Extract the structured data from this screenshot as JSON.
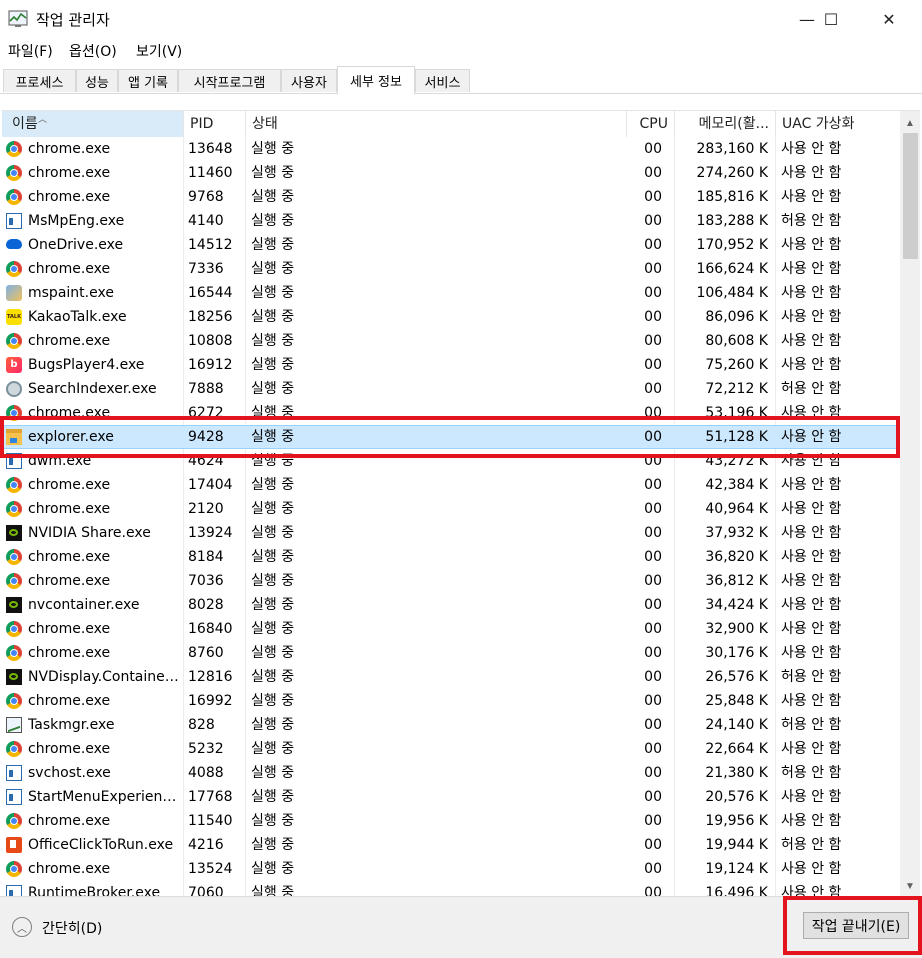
{
  "window": {
    "title": "작업 관리자",
    "minimize": "—",
    "maximize": "☐",
    "close": "✕"
  },
  "menu": [
    "파일(F)",
    "옵션(O)",
    "보기(V)"
  ],
  "tabs": [
    "프로세스",
    "성능",
    "앱 기록",
    "시작프로그램",
    "사용자",
    "세부 정보",
    "서비스"
  ],
  "active_tab": "세부 정보",
  "columns": {
    "name": "이름",
    "pid": "PID",
    "status": "상태",
    "cpu": "CPU",
    "memory": "메모리(활...",
    "uac": "UAC 가상화"
  },
  "rows": [
    {
      "name": "chrome.exe",
      "pid": "13648",
      "status": "실행 중",
      "cpu": "00",
      "mem": "283,160 K",
      "uac": "사용 안 함",
      "icon": "chrome-icon"
    },
    {
      "name": "chrome.exe",
      "pid": "11460",
      "status": "실행 중",
      "cpu": "00",
      "mem": "274,260 K",
      "uac": "사용 안 함",
      "icon": "chrome-icon"
    },
    {
      "name": "chrome.exe",
      "pid": "9768",
      "status": "실행 중",
      "cpu": "00",
      "mem": "185,816 K",
      "uac": "사용 안 함",
      "icon": "chrome-icon"
    },
    {
      "name": "MsMpEng.exe",
      "pid": "4140",
      "status": "실행 중",
      "cpu": "00",
      "mem": "183,288 K",
      "uac": "허용 안 함",
      "icon": "service-window-icon"
    },
    {
      "name": "OneDrive.exe",
      "pid": "14512",
      "status": "실행 중",
      "cpu": "00",
      "mem": "170,952 K",
      "uac": "사용 안 함",
      "icon": "onedrive-cloud-icon"
    },
    {
      "name": "chrome.exe",
      "pid": "7336",
      "status": "실행 중",
      "cpu": "00",
      "mem": "166,624 K",
      "uac": "사용 안 함",
      "icon": "chrome-icon"
    },
    {
      "name": "mspaint.exe",
      "pid": "16544",
      "status": "실행 중",
      "cpu": "00",
      "mem": "106,484 K",
      "uac": "사용 안 함",
      "icon": "paint-icon"
    },
    {
      "name": "KakaoTalk.exe",
      "pid": "18256",
      "status": "실행 중",
      "cpu": "00",
      "mem": "86,096 K",
      "uac": "사용 안 함",
      "icon": "kakaotalk-icon"
    },
    {
      "name": "chrome.exe",
      "pid": "10808",
      "status": "실행 중",
      "cpu": "00",
      "mem": "80,608 K",
      "uac": "사용 안 함",
      "icon": "chrome-icon"
    },
    {
      "name": "BugsPlayer4.exe",
      "pid": "16912",
      "status": "실행 중",
      "cpu": "00",
      "mem": "75,260 K",
      "uac": "사용 안 함",
      "icon": "bugs-player-icon"
    },
    {
      "name": "SearchIndexer.exe",
      "pid": "7888",
      "status": "실행 중",
      "cpu": "00",
      "mem": "72,212 K",
      "uac": "허용 안 함",
      "icon": "search-indexer-icon"
    },
    {
      "name": "chrome.exe",
      "pid": "6272",
      "status": "실행 중",
      "cpu": "00",
      "mem": "53,196 K",
      "uac": "사용 안 함",
      "icon": "chrome-icon"
    },
    {
      "name": "explorer.exe",
      "pid": "9428",
      "status": "실행 중",
      "cpu": "00",
      "mem": "51,128 K",
      "uac": "사용 안 함",
      "icon": "file-explorer-icon",
      "selected": true
    },
    {
      "name": "dwm.exe",
      "pid": "4624",
      "status": "실행 중",
      "cpu": "00",
      "mem": "43,272 K",
      "uac": "사용 안 함",
      "icon": "service-window-icon"
    },
    {
      "name": "chrome.exe",
      "pid": "17404",
      "status": "실행 중",
      "cpu": "00",
      "mem": "42,384 K",
      "uac": "사용 안 함",
      "icon": "chrome-icon"
    },
    {
      "name": "chrome.exe",
      "pid": "2120",
      "status": "실행 중",
      "cpu": "00",
      "mem": "40,964 K",
      "uac": "사용 안 함",
      "icon": "chrome-icon"
    },
    {
      "name": "NVIDIA Share.exe",
      "pid": "13924",
      "status": "실행 중",
      "cpu": "00",
      "mem": "37,932 K",
      "uac": "사용 안 함",
      "icon": "nvidia-icon"
    },
    {
      "name": "chrome.exe",
      "pid": "8184",
      "status": "실행 중",
      "cpu": "00",
      "mem": "36,820 K",
      "uac": "사용 안 함",
      "icon": "chrome-icon"
    },
    {
      "name": "chrome.exe",
      "pid": "7036",
      "status": "실행 중",
      "cpu": "00",
      "mem": "36,812 K",
      "uac": "사용 안 함",
      "icon": "chrome-icon"
    },
    {
      "name": "nvcontainer.exe",
      "pid": "8028",
      "status": "실행 중",
      "cpu": "00",
      "mem": "34,424 K",
      "uac": "사용 안 함",
      "icon": "nvidia-icon"
    },
    {
      "name": "chrome.exe",
      "pid": "16840",
      "status": "실행 중",
      "cpu": "00",
      "mem": "32,900 K",
      "uac": "사용 안 함",
      "icon": "chrome-icon"
    },
    {
      "name": "chrome.exe",
      "pid": "8760",
      "status": "실행 중",
      "cpu": "00",
      "mem": "30,176 K",
      "uac": "사용 안 함",
      "icon": "chrome-icon"
    },
    {
      "name": "NVDisplay.Container...",
      "pid": "12816",
      "status": "실행 중",
      "cpu": "00",
      "mem": "26,576 K",
      "uac": "허용 안 함",
      "icon": "nvidia-icon"
    },
    {
      "name": "chrome.exe",
      "pid": "16992",
      "status": "실행 중",
      "cpu": "00",
      "mem": "25,848 K",
      "uac": "사용 안 함",
      "icon": "chrome-icon"
    },
    {
      "name": "Taskmgr.exe",
      "pid": "828",
      "status": "실행 중",
      "cpu": "00",
      "mem": "24,140 K",
      "uac": "허용 안 함",
      "icon": "task-manager-icon"
    },
    {
      "name": "chrome.exe",
      "pid": "5232",
      "status": "실행 중",
      "cpu": "00",
      "mem": "22,664 K",
      "uac": "사용 안 함",
      "icon": "chrome-icon"
    },
    {
      "name": "svchost.exe",
      "pid": "4088",
      "status": "실행 중",
      "cpu": "00",
      "mem": "21,380 K",
      "uac": "허용 안 함",
      "icon": "service-window-icon"
    },
    {
      "name": "StartMenuExperienc...",
      "pid": "17768",
      "status": "실행 중",
      "cpu": "00",
      "mem": "20,576 K",
      "uac": "사용 안 함",
      "icon": "service-window-icon"
    },
    {
      "name": "chrome.exe",
      "pid": "11540",
      "status": "실행 중",
      "cpu": "00",
      "mem": "19,956 K",
      "uac": "사용 안 함",
      "icon": "chrome-icon"
    },
    {
      "name": "OfficeClickToRun.exe",
      "pid": "4216",
      "status": "실행 중",
      "cpu": "00",
      "mem": "19,944 K",
      "uac": "허용 안 함",
      "icon": "office-icon"
    },
    {
      "name": "chrome.exe",
      "pid": "13524",
      "status": "실행 중",
      "cpu": "00",
      "mem": "19,124 K",
      "uac": "사용 안 함",
      "icon": "chrome-icon"
    },
    {
      "name": "RuntimeBroker.exe",
      "pid": "7060",
      "status": "실행 중",
      "cpu": "00",
      "mem": "16,496 K",
      "uac": "사용 안 함",
      "icon": "service-window-icon"
    }
  ],
  "footer": {
    "fewer_details": "간단히(D)",
    "end_task": "작업 끝내기(E)"
  },
  "colors": {
    "selected_row": "#cce8ff",
    "highlight_box": "#e3141e",
    "sorted_header": "#d9ebf9"
  }
}
